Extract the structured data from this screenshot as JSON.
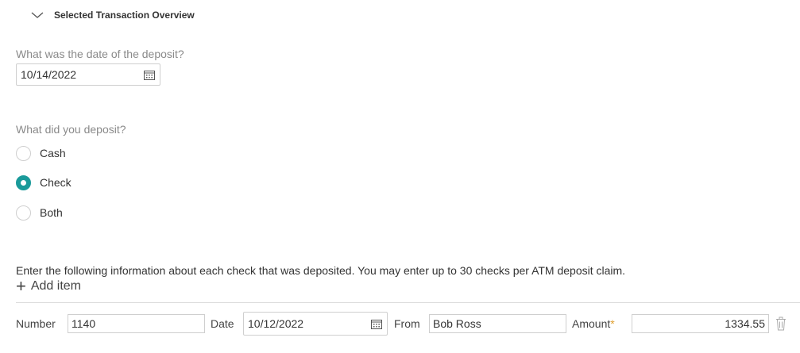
{
  "section": {
    "title": "Selected Transaction Overview",
    "toggle_icon": "chevron-down-icon"
  },
  "deposit_date": {
    "question": "What was the date of the deposit?",
    "value": "10/14/2022",
    "icon": "calendar-icon"
  },
  "deposit_type": {
    "question": "What did you deposit?",
    "options": [
      "Cash",
      "Check",
      "Both"
    ],
    "selected": "Check"
  },
  "checks": {
    "instructions": "Enter the following information about each check that was deposited. You may enter up to 30 checks per ATM deposit claim.",
    "add_label": "Add item",
    "labels": {
      "number": "Number",
      "date": "Date",
      "from": "From",
      "amount": "Amount"
    },
    "items": [
      {
        "number": "1140",
        "date": "10/12/2022",
        "from": "Bob Ross",
        "amount": "1334.55"
      }
    ]
  },
  "colors": {
    "accent": "#1a9a9a",
    "required": "#e0a030"
  }
}
